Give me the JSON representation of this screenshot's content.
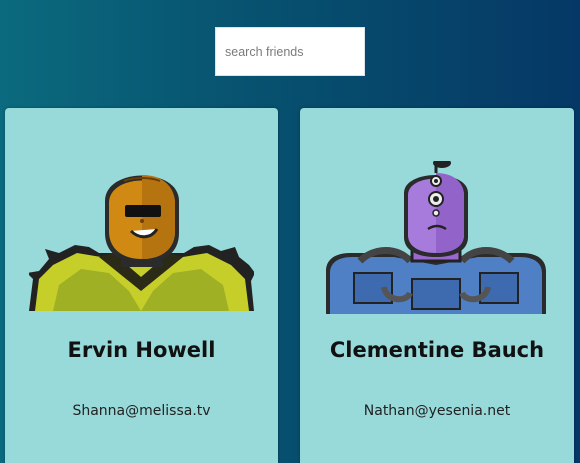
{
  "search": {
    "placeholder": "search friends",
    "value": ""
  },
  "cards": [
    {
      "name": "Ervin Howell",
      "email": "Shanna@melissa.tv",
      "avatar_icon": "robot-avatar-gold-head-green-armor"
    },
    {
      "name": "Clementine Bauch",
      "email": "Nathan@yesenia.net",
      "avatar_icon": "robot-avatar-purple-cyclops-blue-armor"
    }
  ],
  "colors": {
    "card_background": "#98d9da",
    "background_start": "#0b6a7e",
    "background_end": "#053866"
  }
}
